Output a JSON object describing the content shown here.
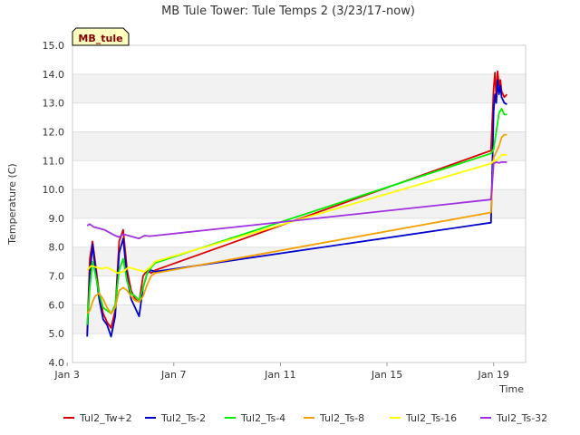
{
  "chart_data": {
    "type": "line",
    "title": "MB Tule Tower: Tule Temps 2 (3/23/17-now)",
    "xlabel": "Time",
    "ylabel": "Temperature (C)",
    "badge": "MB_tule",
    "xlim": [
      3.2,
      20.2
    ],
    "ylim": [
      4.0,
      15.0
    ],
    "x_ticks": [
      {
        "v": 3,
        "label": "Jan 3"
      },
      {
        "v": 7,
        "label": "Jan 7"
      },
      {
        "v": 11,
        "label": "Jan 11"
      },
      {
        "v": 15,
        "label": "Jan 15"
      },
      {
        "v": 19,
        "label": "Jan 19"
      }
    ],
    "y_ticks": [
      "4.0",
      "5.0",
      "6.0",
      "7.0",
      "8.0",
      "9.0",
      "10.0",
      "11.0",
      "12.0",
      "13.0",
      "14.0",
      "15.0"
    ],
    "grid": "horizontal bands",
    "legend_position": "bottom",
    "series": [
      {
        "name": "Tul2_Tw+2",
        "color": "#dd0000",
        "x": [
          3.75,
          3.85,
          3.95,
          4.05,
          4.2,
          4.35,
          4.5,
          4.65,
          4.8,
          4.95,
          5.1,
          5.25,
          5.4,
          5.55,
          5.7,
          5.85,
          6.0,
          6.15,
          6.3,
          18.9,
          19.0,
          19.05,
          19.1,
          19.15,
          19.2,
          19.25,
          19.3,
          19.4,
          19.5
        ],
        "values": [
          5.0,
          7.6,
          8.2,
          7.5,
          6.4,
          5.7,
          5.4,
          5.2,
          5.8,
          8.2,
          8.6,
          7.2,
          6.5,
          6.2,
          6.1,
          7.0,
          7.2,
          7.1,
          7.2,
          11.35,
          13.5,
          14.05,
          13.2,
          14.1,
          13.6,
          13.8,
          13.4,
          13.2,
          13.3
        ]
      },
      {
        "name": "Tul2_Ts-2",
        "color": "#0000cc",
        "x": [
          3.75,
          3.85,
          3.95,
          4.05,
          4.2,
          4.35,
          4.5,
          4.65,
          4.8,
          4.95,
          5.1,
          5.25,
          5.4,
          5.55,
          5.7,
          5.85,
          6.0,
          6.15,
          6.3,
          18.9,
          19.0,
          19.05,
          19.1,
          19.15,
          19.2,
          19.25,
          19.3,
          19.4,
          19.5
        ],
        "values": [
          4.9,
          7.0,
          8.1,
          7.3,
          6.2,
          5.5,
          5.3,
          4.9,
          5.6,
          7.8,
          8.3,
          6.9,
          6.2,
          5.9,
          5.6,
          6.6,
          7.1,
          7.2,
          7.15,
          8.85,
          12.7,
          13.3,
          13.0,
          13.8,
          13.3,
          13.6,
          13.2,
          13.0,
          12.95
        ]
      },
      {
        "name": "Tul2_Ts-4",
        "color": "#00ee00",
        "x": [
          3.75,
          3.85,
          3.95,
          4.05,
          4.2,
          4.35,
          4.5,
          4.65,
          4.8,
          4.95,
          5.1,
          5.25,
          5.4,
          5.55,
          5.7,
          5.85,
          6.0,
          6.15,
          6.3,
          18.9,
          19.0,
          19.1,
          19.2,
          19.3,
          19.4,
          19.5
        ],
        "values": [
          5.3,
          6.6,
          7.5,
          7.1,
          6.4,
          5.9,
          5.8,
          5.7,
          6.0,
          7.2,
          7.6,
          6.8,
          6.4,
          6.3,
          6.15,
          6.6,
          7.1,
          7.3,
          7.45,
          11.25,
          11.4,
          12.0,
          12.65,
          12.8,
          12.6,
          12.6
        ]
      },
      {
        "name": "Tul2_Ts-8",
        "color": "#f5a000",
        "x": [
          3.75,
          3.85,
          3.95,
          4.05,
          4.2,
          4.35,
          4.5,
          4.65,
          4.8,
          4.95,
          5.1,
          5.25,
          5.4,
          5.55,
          5.7,
          5.85,
          6.0,
          6.15,
          6.3,
          18.9,
          19.0,
          19.1,
          19.2,
          19.3,
          19.4,
          19.5
        ],
        "values": [
          5.7,
          5.8,
          6.1,
          6.3,
          6.4,
          6.2,
          5.9,
          5.7,
          5.9,
          6.5,
          6.6,
          6.5,
          6.3,
          6.15,
          6.1,
          6.3,
          6.7,
          7.0,
          7.1,
          9.2,
          11.1,
          11.3,
          11.5,
          11.8,
          11.9,
          11.9
        ]
      },
      {
        "name": "Tul2_Ts-16",
        "color": "#ffff00",
        "x": [
          3.75,
          3.9,
          4.1,
          4.3,
          4.5,
          4.7,
          4.9,
          5.1,
          5.3,
          5.5,
          5.7,
          5.9,
          6.1,
          6.3,
          18.9,
          19.0,
          19.1,
          19.2,
          19.3,
          19.4,
          19.5
        ],
        "values": [
          7.2,
          7.35,
          7.3,
          7.25,
          7.3,
          7.2,
          7.1,
          7.15,
          7.3,
          7.25,
          7.2,
          7.15,
          7.3,
          7.5,
          10.9,
          11.0,
          11.0,
          11.1,
          11.2,
          11.2,
          11.2
        ]
      },
      {
        "name": "Tul2_Ts-32",
        "color": "#a030e0",
        "x": [
          3.75,
          3.85,
          4.0,
          4.2,
          4.4,
          4.6,
          4.8,
          4.95,
          5.1,
          5.3,
          5.5,
          5.7,
          5.9,
          6.1,
          6.3,
          18.9,
          19.0,
          19.1,
          19.2,
          19.3,
          19.4,
          19.5
        ],
        "values": [
          8.75,
          8.8,
          8.7,
          8.65,
          8.6,
          8.5,
          8.4,
          8.35,
          8.45,
          8.4,
          8.35,
          8.3,
          8.4,
          8.38,
          8.4,
          9.65,
          10.9,
          10.95,
          10.92,
          10.95,
          10.95,
          10.95
        ]
      }
    ]
  }
}
